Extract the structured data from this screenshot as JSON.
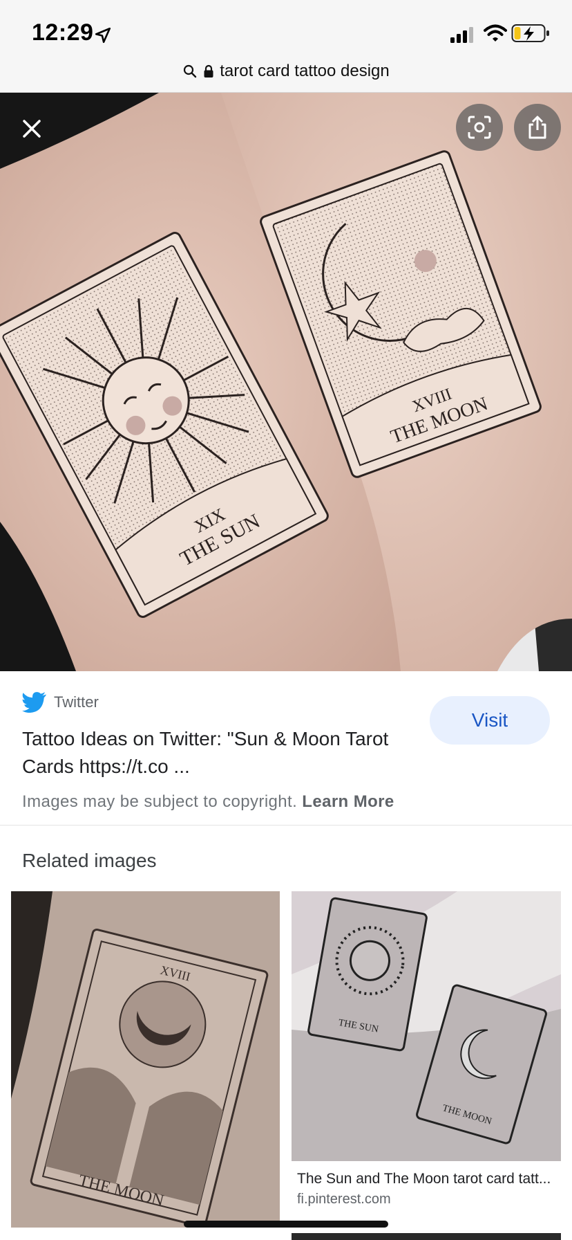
{
  "status_bar": {
    "time": "12:29",
    "icons": [
      "location-arrow-icon",
      "cellular-signal-icon",
      "wifi-icon",
      "battery-charging-icon"
    ],
    "battery_color": "#f5c518"
  },
  "url_bar": {
    "query": "tarot card tattoo design",
    "icons": [
      "search-icon",
      "lock-icon"
    ]
  },
  "hero_image": {
    "card_left_numeral": "XIX",
    "card_left_name": "THE SUN",
    "card_right_numeral": "XVIII",
    "card_right_name": "THE MOON",
    "buttons": [
      "close-icon",
      "lens-icon",
      "share-icon"
    ]
  },
  "result": {
    "source": "Twitter",
    "source_icon": "twitter-bird-icon",
    "source_color": "#1d9bf0",
    "title": "Tattoo Ideas on Twitter: \"Sun & Moon Tarot Cards https://t.co ...",
    "visit_label": "Visit",
    "copyright_text": "Images may be subject to copyright.",
    "learn_more_label": "Learn More"
  },
  "related": {
    "heading": "Related images",
    "items": [
      {
        "image_text": "THE MOON",
        "numeral": "XVIII"
      },
      {
        "title": "The Sun and The Moon tarot card tatt...",
        "domain": "fi.pinterest.com",
        "card_1": "THE SUN",
        "card_2": "THE MOON"
      }
    ]
  }
}
